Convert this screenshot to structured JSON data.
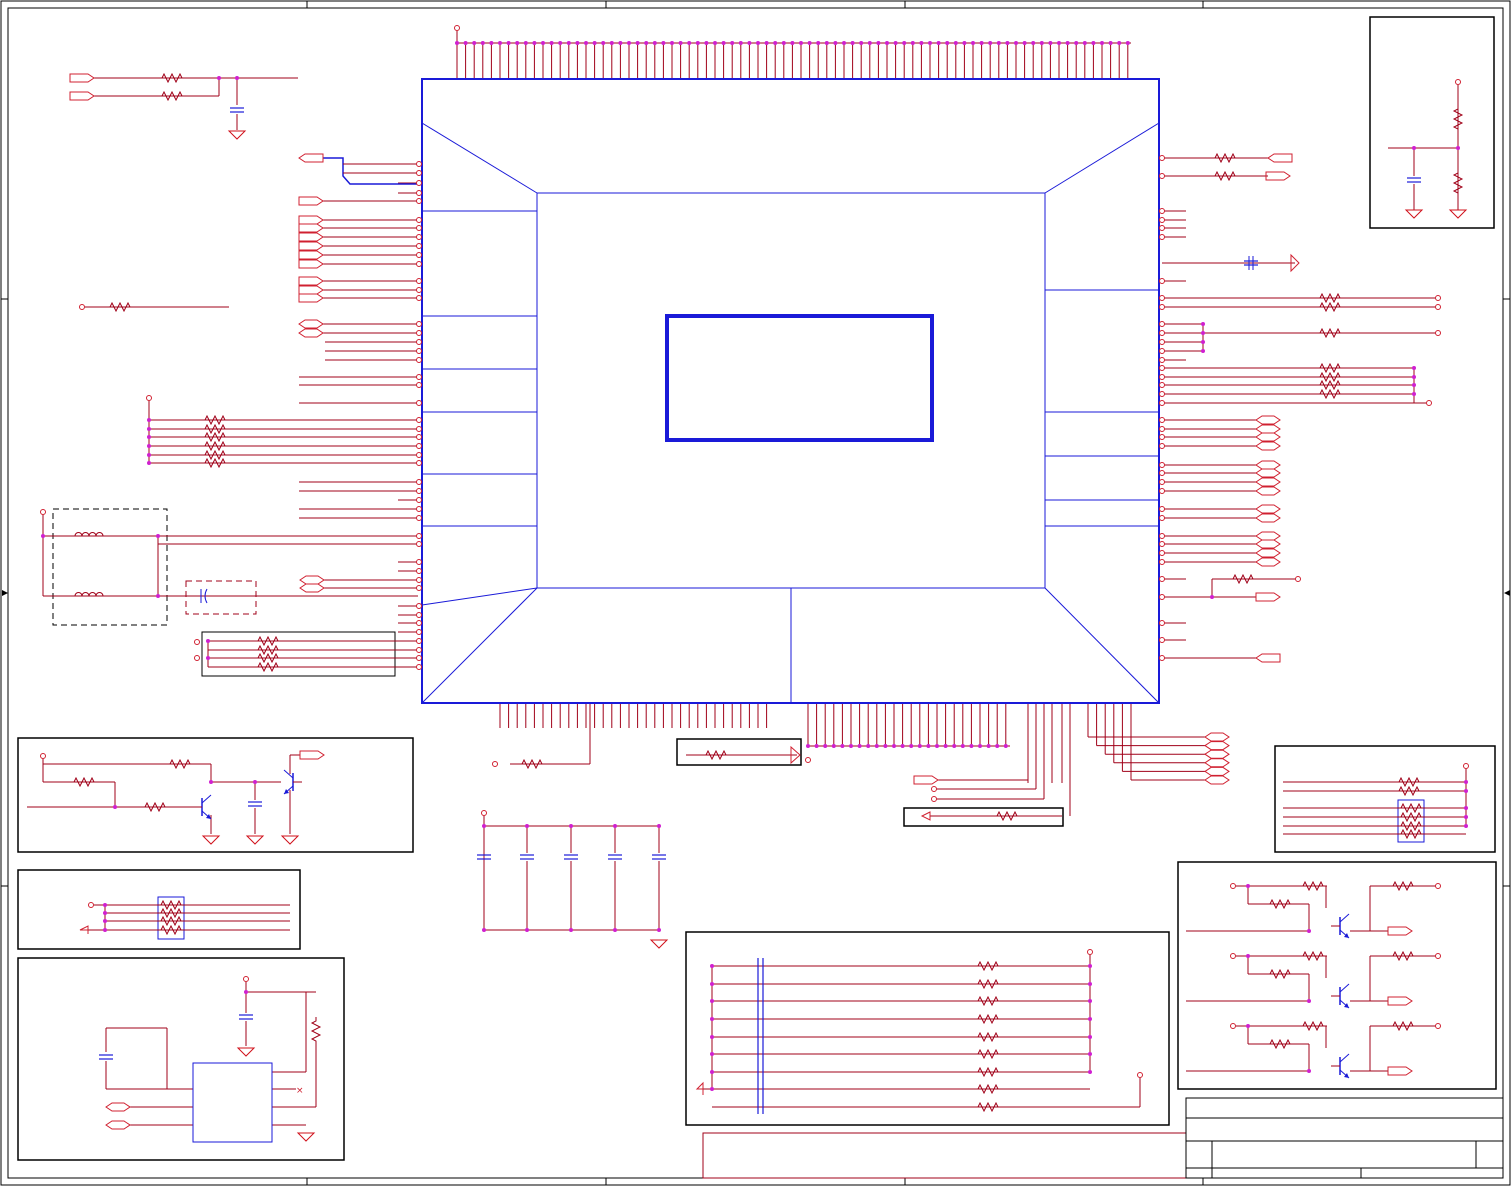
{
  "sheet": {
    "type": "schematic",
    "title_block_text": "",
    "colors": {
      "wire": "#a00018",
      "pin": "#d02030",
      "junction": "#d020d0",
      "part": "#1a1ad8",
      "border": "#000000",
      "gnd": "#d0101a"
    }
  },
  "icons": {
    "ground": "ground-symbol-icon",
    "resistor": "resistor-icon",
    "capacitor": "capacitor-icon",
    "inductor": "inductor-icon",
    "transistor": "npn-transistor-icon",
    "port": "net-port-icon",
    "power": "power-pin-icon"
  }
}
